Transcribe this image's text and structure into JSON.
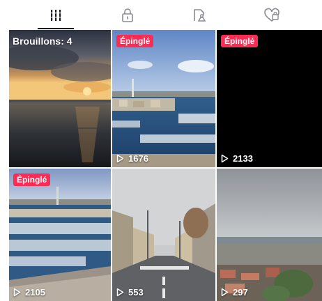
{
  "tabs": [
    {
      "icon": "grid-icon",
      "active": true
    },
    {
      "icon": "lock-icon",
      "active": false
    },
    {
      "icon": "tagged-icon",
      "active": false
    },
    {
      "icon": "heart-icon",
      "active": false
    }
  ],
  "videos": [
    {
      "drafts_label": "Brouillons: 4",
      "scene": "sunset-sea"
    },
    {
      "badge": "Épinglé",
      "views": "1676",
      "scene": "harbor-marina"
    },
    {
      "badge": "Épinglé",
      "views": "2133",
      "scene": "black"
    },
    {
      "badge": "Épinglé",
      "views": "2105",
      "scene": "harbor-aerial"
    },
    {
      "views": "553",
      "scene": "street"
    },
    {
      "views": "297",
      "scene": "rooftops-sea"
    }
  ],
  "colors": {
    "badge": "#fe2c55",
    "tab_icon": "#8a8b91",
    "tab_active": "#161823"
  }
}
